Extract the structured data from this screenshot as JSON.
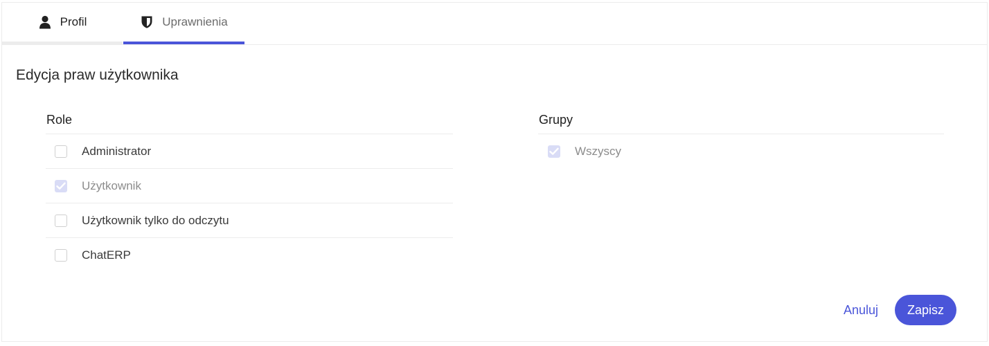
{
  "tabs": [
    {
      "label": "Profil",
      "icon": "user-icon",
      "active": false
    },
    {
      "label": "Uprawnienia",
      "icon": "shield-icon",
      "active": true
    }
  ],
  "page_title": "Edycja praw użytkownika",
  "roles": {
    "header": "Role",
    "items": [
      {
        "label": "Administrator",
        "checked": false,
        "disabled": false
      },
      {
        "label": "Użytkownik",
        "checked": true,
        "disabled": true
      },
      {
        "label": "Użytkownik tylko do odczytu",
        "checked": false,
        "disabled": false
      },
      {
        "label": "ChatERP",
        "checked": false,
        "disabled": false
      }
    ]
  },
  "groups": {
    "header": "Grupy",
    "items": [
      {
        "label": "Wszyscy",
        "checked": true,
        "disabled": true
      }
    ]
  },
  "actions": {
    "cancel_label": "Anuluj",
    "save_label": "Zapisz"
  },
  "colors": {
    "accent": "#4a55d9",
    "checkbox_disabled_checked": "#d9dcf6"
  }
}
